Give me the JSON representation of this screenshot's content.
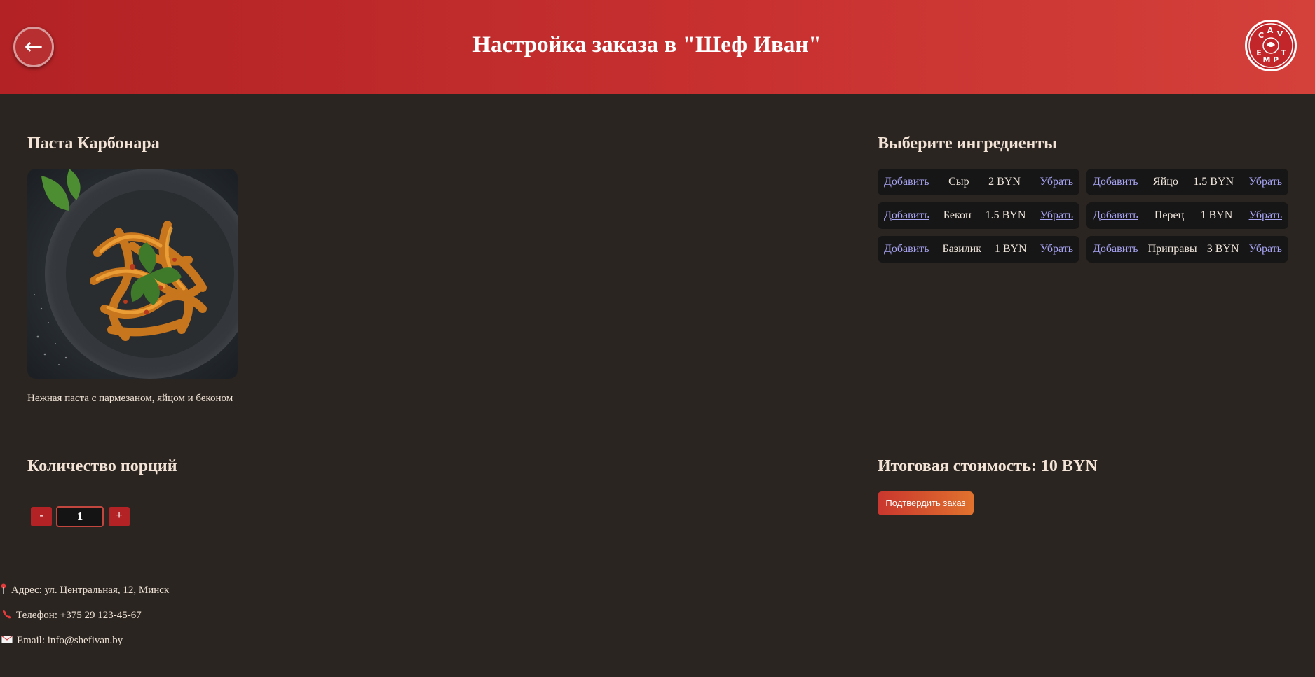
{
  "header": {
    "back_label": "←",
    "title": "Настройка заказа в \"Шеф Иван\"",
    "logo_text": [
      "C",
      "A",
      "V",
      "E",
      "M",
      "P",
      "T"
    ]
  },
  "dish": {
    "title": "Паста Карбонара",
    "description": "Нежная паста с пармезаном, яйцом и беконом",
    "image_icon": "pasta-plate-image"
  },
  "ingredients": {
    "title": "Выберите ингредиенты",
    "add_label": "Добавить",
    "remove_label": "Убрать",
    "items": [
      {
        "name": "Сыр",
        "price": "2 BYN"
      },
      {
        "name": "Яйцо",
        "price": "1.5 BYN"
      },
      {
        "name": "Бекон",
        "price": "1.5 BYN"
      },
      {
        "name": "Перец",
        "price": "1 BYN"
      },
      {
        "name": "Базилик",
        "price": "1 BYN"
      },
      {
        "name": "Приправы",
        "price": "3 BYN"
      }
    ]
  },
  "quantity": {
    "title": "Количество порций",
    "minus_label": "-",
    "value": "1",
    "plus_label": "+"
  },
  "total": {
    "label": "Итоговая стоимость: 10 BYN",
    "confirm_label": "Подтвердить заказ"
  },
  "contacts": {
    "address": "Адрес: ул. Центральная, 12, Минск",
    "phone": "Телефон: +375 29 123-45-67",
    "email": "Email: info@shefivan.by"
  },
  "colors": {
    "header_start": "#b32225",
    "header_end": "#d4403a",
    "background": "#2a2520",
    "link": "#a9a5f5",
    "confirm_start": "#c9362e",
    "confirm_end": "#e0722e"
  }
}
